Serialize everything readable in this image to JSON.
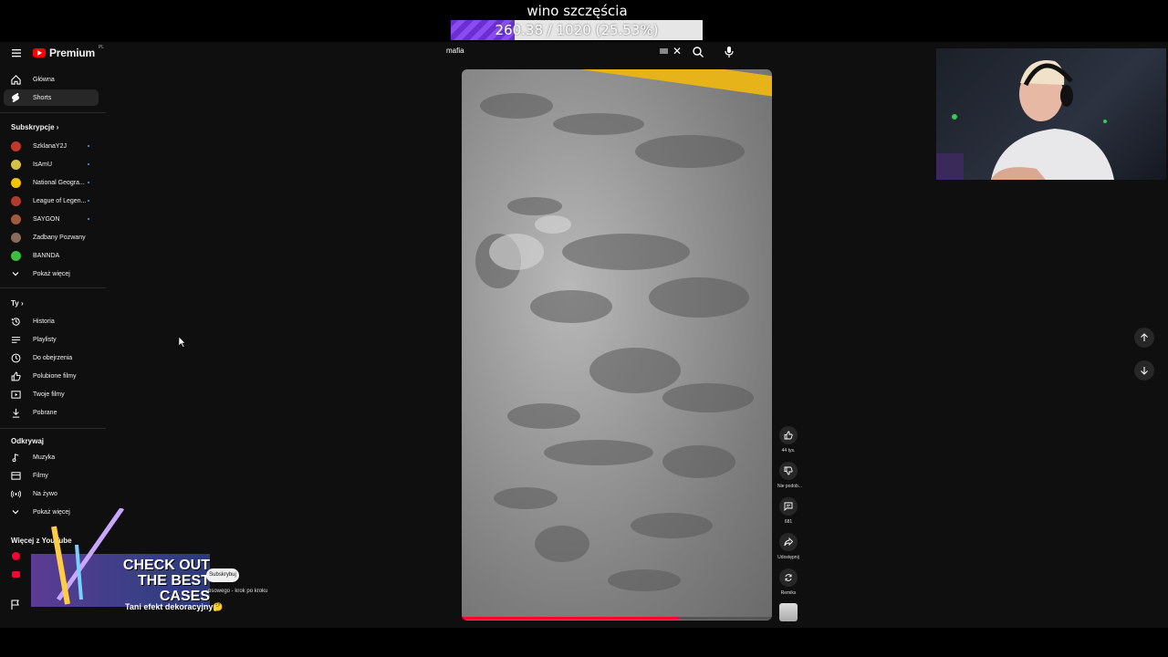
{
  "stream_goal": {
    "title": "wino szczęścia",
    "progress_text": "260.38 / 1020 (25.53%)",
    "current": 260.38,
    "target": 1020,
    "fraction": 0.2553
  },
  "header": {
    "logo_text": "Premium",
    "logo_region": "PL",
    "search_value": "mafia"
  },
  "sidebar": {
    "main": [
      {
        "label": "Główna",
        "icon": "home-icon"
      },
      {
        "label": "Shorts",
        "icon": "shorts-icon",
        "active": true
      }
    ],
    "subscriptions_title": "Subskrypcje",
    "subscriptions": [
      {
        "label": "SzklanaY2J",
        "color": "#c0392b"
      },
      {
        "label": "IsAmU",
        "color": "#d4c14a"
      },
      {
        "label": "National Geogra...",
        "color": "#f5c400"
      },
      {
        "label": "League of Legen...",
        "color": "#b03a2e"
      },
      {
        "label": "SAYGON",
        "color": "#a05a3c"
      },
      {
        "label": "Zadbany Pozwany",
        "color": "#8a6a5a"
      },
      {
        "label": "BANNDA",
        "color": "#3cbf3c"
      }
    ],
    "show_more": "Pokaż więcej",
    "you_title": "Ty",
    "you": [
      {
        "label": "Historia",
        "icon": "history-icon"
      },
      {
        "label": "Playlisty",
        "icon": "playlist-icon"
      },
      {
        "label": "Do obejrzenia",
        "icon": "watch-later-icon"
      },
      {
        "label": "Polubione filmy",
        "icon": "like-icon"
      },
      {
        "label": "Twoje filmy",
        "icon": "your-videos-icon"
      },
      {
        "label": "Pobrane",
        "icon": "download-icon"
      }
    ],
    "explore_title": "Odkrywaj",
    "explore": [
      {
        "label": "Muzyka",
        "icon": "music-icon"
      },
      {
        "label": "Filmy",
        "icon": "film-icon"
      },
      {
        "label": "Na żywo",
        "icon": "live-icon"
      },
      {
        "label": "Pokaż więcej",
        "icon": "chevron-down-icon"
      }
    ],
    "more_title": "Więcej z YouTube"
  },
  "short": {
    "likes": "44 tys.",
    "dislike": "Nie podob...",
    "comments": "681",
    "share": "Udostępnij",
    "remix": "Remiks",
    "progress": 0.7,
    "subscribe_label": "Subskrybuj",
    "subtitle": "psowego - krok po kroku",
    "title": "Tani efekt dekoracyjny🤔"
  },
  "ad": {
    "text_line1": "CHECK OUT",
    "text_line2": "THE BEST",
    "text_line3": "CASES"
  },
  "colors": {
    "accent_red": "#ff0000",
    "goal_purple": "#8a4cf0",
    "progress_red": "#ff0033"
  }
}
